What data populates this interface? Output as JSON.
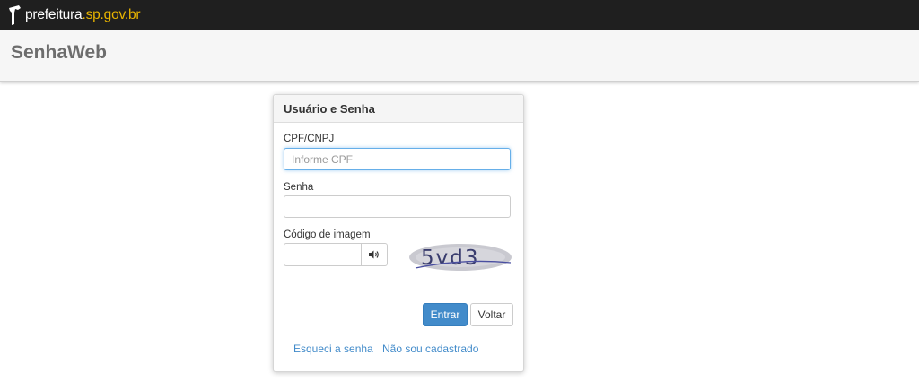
{
  "brand": {
    "logo_prefix": "prefeitura",
    "logo_domain": ".sp.gov.br"
  },
  "app": {
    "title": "SenhaWeb"
  },
  "login_panel": {
    "heading": "Usuário e Senha",
    "cpf": {
      "label": "CPF/CNPJ",
      "placeholder": "Informe CPF",
      "value": ""
    },
    "password": {
      "label": "Senha",
      "value": ""
    },
    "captcha": {
      "label": "Código de imagem",
      "value": "",
      "image_text": "5vd3",
      "audio_icon": "speaker-icon"
    },
    "buttons": {
      "submit": "Entrar",
      "back": "Voltar"
    },
    "links": {
      "forgot": "Esqueci a senha",
      "register": "Não sou cadastrado"
    }
  },
  "colors": {
    "topbar": "#1f1f1f",
    "logo_accent": "#e8b400",
    "primary": "#428bca",
    "link": "#428bca"
  }
}
